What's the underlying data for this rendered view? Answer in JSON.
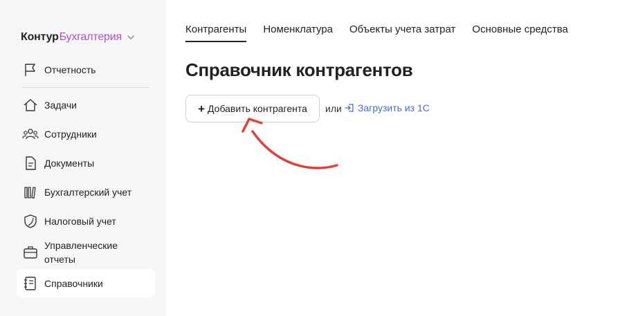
{
  "logo": {
    "brand": "Контур",
    "product": "Бухгалтерия"
  },
  "sidebar": {
    "items": [
      {
        "label": "Отчетность",
        "icon": "flag-icon"
      },
      {
        "label": "Задачи",
        "icon": "home-icon"
      },
      {
        "label": "Сотрудники",
        "icon": "users-icon"
      },
      {
        "label": "Документы",
        "icon": "document-icon"
      },
      {
        "label": "Бухгалтерский учет",
        "icon": "books-icon"
      },
      {
        "label": "Налоговый учет",
        "icon": "shield-icon"
      },
      {
        "label": "Управленческие отчеты",
        "icon": "briefcase-icon"
      },
      {
        "label": "Справочники",
        "icon": "notebook-icon",
        "active": true
      }
    ]
  },
  "tabs": [
    {
      "label": "Контрагенты",
      "active": true
    },
    {
      "label": "Номенклатура"
    },
    {
      "label": "Объекты учета затрат"
    },
    {
      "label": "Основные средства"
    }
  ],
  "main": {
    "title": "Справочник контрагентов",
    "add_button": "Добавить контрагента",
    "or_text": "или",
    "load_link": "Загрузить из 1С"
  },
  "colors": {
    "accent_product": "#b04fc9",
    "link": "#3d6fd0",
    "annotation_arrow": "#e0403a"
  }
}
